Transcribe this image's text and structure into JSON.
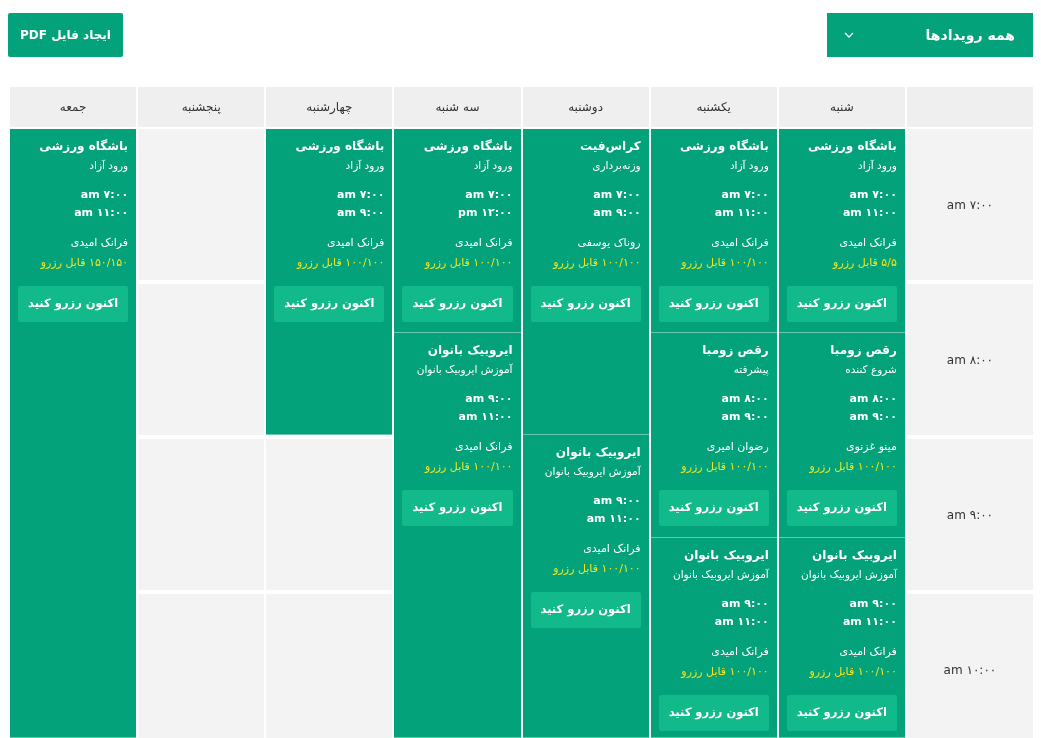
{
  "filter": {
    "label": "همه رویدادها"
  },
  "pdf_button": "ایجاد فایل PDF",
  "times": [
    "۷:۰۰ am",
    "۸:۰۰ am",
    "۹:۰۰ am",
    "۱۰:۰۰ am"
  ],
  "days": [
    {
      "label": "شنبه",
      "events": [
        {
          "title": "باشگاه ورزشی",
          "subtitle": "ورود آزاد",
          "start": "۷:۰۰ am",
          "end": "۱۱:۰۰ am",
          "instructor": "فرانک امیدی",
          "availability": "۵/۵ قابل رزرو",
          "button": "اکنون رزرو کنید"
        },
        {
          "title": "رقص زومبا",
          "subtitle": "شروع کننده",
          "start": "۸:۰۰ am",
          "end": "۹:۰۰ am",
          "instructor": "مینو غزنوی",
          "availability": "۱۰۰/۱۰۰ قابل رزرو",
          "button": "اکنون رزرو کنید"
        },
        {
          "title": "ایروبیک بانوان",
          "subtitle": "آموزش ایروبیک بانوان",
          "start": "۹:۰۰ am",
          "end": "۱۱:۰۰ am",
          "instructor": "فرانک امیدی",
          "availability": "۱۰۰/۱۰۰ قابل رزرو",
          "button": "اکنون رزرو کنید"
        }
      ]
    },
    {
      "label": "یکشنبه",
      "events": [
        {
          "title": "باشگاه ورزشی",
          "subtitle": "ورود آزاد",
          "start": "۷:۰۰ am",
          "end": "۱۱:۰۰ am",
          "instructor": "فرانک امیدی",
          "availability": "۱۰۰/۱۰۰ قابل رزرو",
          "button": "اکنون رزرو کنید"
        },
        {
          "title": "رقص زومبا",
          "subtitle": "پیشرفته",
          "start": "۸:۰۰ am",
          "end": "۹:۰۰ am",
          "instructor": "رضوان امیری",
          "availability": "۱۰۰/۱۰۰ قابل رزرو",
          "button": "اکنون رزرو کنید"
        },
        {
          "title": "ایروبیک بانوان",
          "subtitle": "آموزش ایروبیک بانوان",
          "start": "۹:۰۰ am",
          "end": "۱۱:۰۰ am",
          "instructor": "فرانک امیدی",
          "availability": "۱۰۰/۱۰۰ قابل رزرو",
          "button": "اکنون رزرو کنید"
        }
      ]
    },
    {
      "label": "دوشنبه",
      "events": [
        {
          "title": "کراس‌فیت",
          "subtitle": "وزنه‌برداری",
          "start": "۷:۰۰ am",
          "end": "۹:۰۰ am",
          "instructor": "روناک یوسفی",
          "availability": "۱۰۰/۱۰۰ قابل رزرو",
          "button": "اکنون رزرو کنید"
        },
        {
          "title": "ایروبیک بانوان",
          "subtitle": "آموزش ایروبیک بانوان",
          "start": "۹:۰۰ am",
          "end": "۱۱:۰۰ am",
          "instructor": "فرانک امیدی",
          "availability": "۱۰۰/۱۰۰ قابل رزرو",
          "button": "اکنون رزرو کنید"
        }
      ]
    },
    {
      "label": "سه شنبه",
      "events": [
        {
          "title": "باشگاه ورزشی",
          "subtitle": "ورود آزاد",
          "start": "۷:۰۰ am",
          "end": "۱۲:۰۰ pm",
          "instructor": "فرانک امیدی",
          "availability": "۱۰۰/۱۰۰ قابل رزرو",
          "button": "اکنون رزرو کنید"
        },
        {
          "title": "ایروبیک بانوان",
          "subtitle": "آموزش ایروبیک بانوان",
          "start": "۹:۰۰ am",
          "end": "۱۱:۰۰ am",
          "instructor": "فرانک امیدی",
          "availability": "۱۰۰/۱۰۰ قابل رزرو",
          "button": "اکنون رزرو کنید"
        }
      ]
    },
    {
      "label": "چهارشنبه",
      "events": [
        {
          "title": "باشگاه ورزشی",
          "subtitle": "ورود آزاد",
          "start": "۷:۰۰ am",
          "end": "۹:۰۰ am",
          "instructor": "فرانک امیدی",
          "availability": "۱۰۰/۱۰۰ قابل رزرو",
          "button": "اکنون رزرو کنید"
        }
      ]
    },
    {
      "label": "پنجشنبه"
    },
    {
      "label": "جمعه",
      "events": [
        {
          "title": "باشگاه ورزشی",
          "subtitle": "ورود آزاد",
          "start": "۷:۰۰ am",
          "end": "۱۱:۰۰ am",
          "instructor": "فرانک امیدی",
          "availability": "۱۵۰/۱۵۰ قابل رزرو",
          "button": "اکنون رزرو کنید"
        }
      ]
    }
  ]
}
